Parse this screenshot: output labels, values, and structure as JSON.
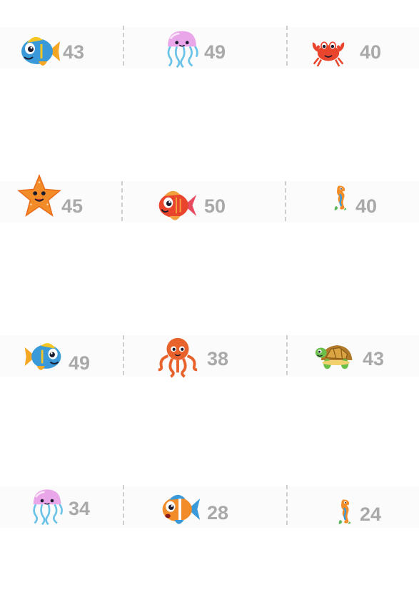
{
  "cards": [
    {
      "creature": "fish-blue-icon",
      "number": "43"
    },
    {
      "creature": "jellyfish-icon",
      "number": "49"
    },
    {
      "creature": "crab-icon",
      "number": "40"
    },
    {
      "creature": "starfish-icon",
      "number": "45"
    },
    {
      "creature": "fish-red-icon",
      "number": "50"
    },
    {
      "creature": "seahorse-icon",
      "number": "40"
    },
    {
      "creature": "fish-blue-icon",
      "number": "49"
    },
    {
      "creature": "octopus-icon",
      "number": "38"
    },
    {
      "creature": "turtle-icon",
      "number": "43"
    },
    {
      "creature": "jellyfish-icon",
      "number": "34"
    },
    {
      "creature": "fish-orange-icon",
      "number": "28"
    },
    {
      "creature": "seahorse-icon",
      "number": "24"
    }
  ],
  "colors": {
    "number": "#a9a9a9",
    "divider": "#cfcfcf",
    "band": "#fbfbfb"
  }
}
